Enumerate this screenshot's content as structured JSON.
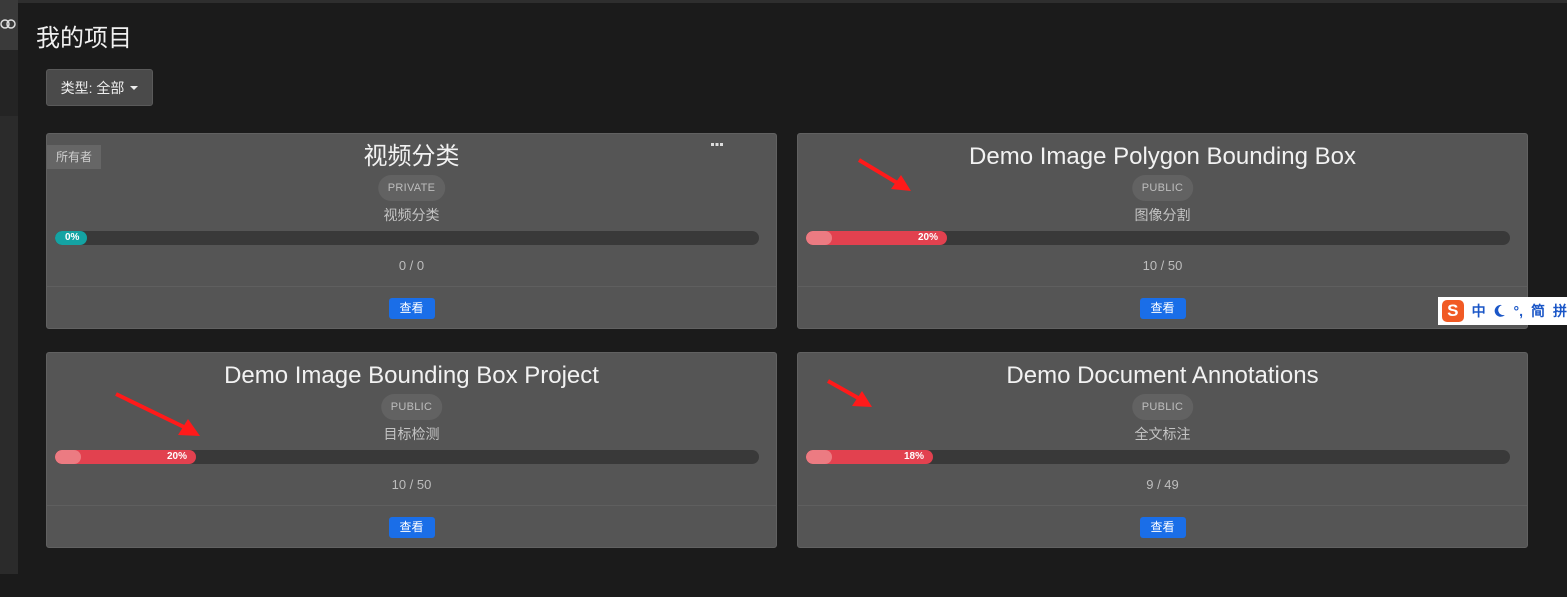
{
  "page": {
    "title": "我的项目"
  },
  "filter": {
    "label": "类型: 全部"
  },
  "owner_tag": "所有者",
  "view_label": "查看",
  "projects": [
    {
      "title": "视频分类",
      "visibility": "PRIVATE",
      "type": "视频分类",
      "progress_label": "0%",
      "progress": 0,
      "count": "0 / 0"
    },
    {
      "title": "Demo Image Polygon Bounding Box",
      "visibility": "PUBLIC",
      "type": "图像分割",
      "progress_label": "20%",
      "progress": 0.2,
      "count": "10 / 50"
    },
    {
      "title": "Demo Image Bounding Box Project",
      "visibility": "PUBLIC",
      "type": "目标检测",
      "progress_label": "20%",
      "progress": 0.2,
      "count": "10 / 50"
    },
    {
      "title": "Demo Document Annotations",
      "visibility": "PUBLIC",
      "type": "全文标注",
      "progress_label": "18%",
      "progress": 0.18,
      "count": "9 / 49"
    }
  ],
  "ime": {
    "logo": "S",
    "items": [
      "中",
      "°,",
      "简",
      "拼"
    ]
  },
  "colors": {
    "progress_red": "#e2414f",
    "progress_teal": "#14a3a3",
    "view_button": "#1a6ee8",
    "arrow": "#ff1a1a"
  }
}
